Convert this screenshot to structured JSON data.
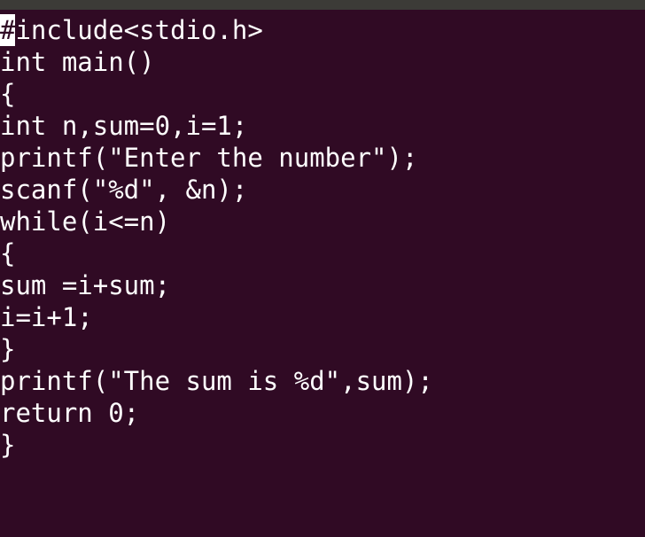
{
  "editor": {
    "cursor_char": "#",
    "lines": [
      "include<stdio.h>",
      "int main()",
      "{",
      "int n,sum=0,i=1;",
      "printf(\"Enter the number\");",
      "scanf(\"%d\", &n);",
      "while(i<=n)",
      "{",
      "sum =i+sum;",
      "i=i+1;",
      "}",
      "printf(\"The sum is %d\",sum);",
      "return 0;",
      "}"
    ]
  },
  "colors": {
    "background": "#300a24",
    "text": "#ffffff",
    "title_strip": "#3c3b37"
  }
}
